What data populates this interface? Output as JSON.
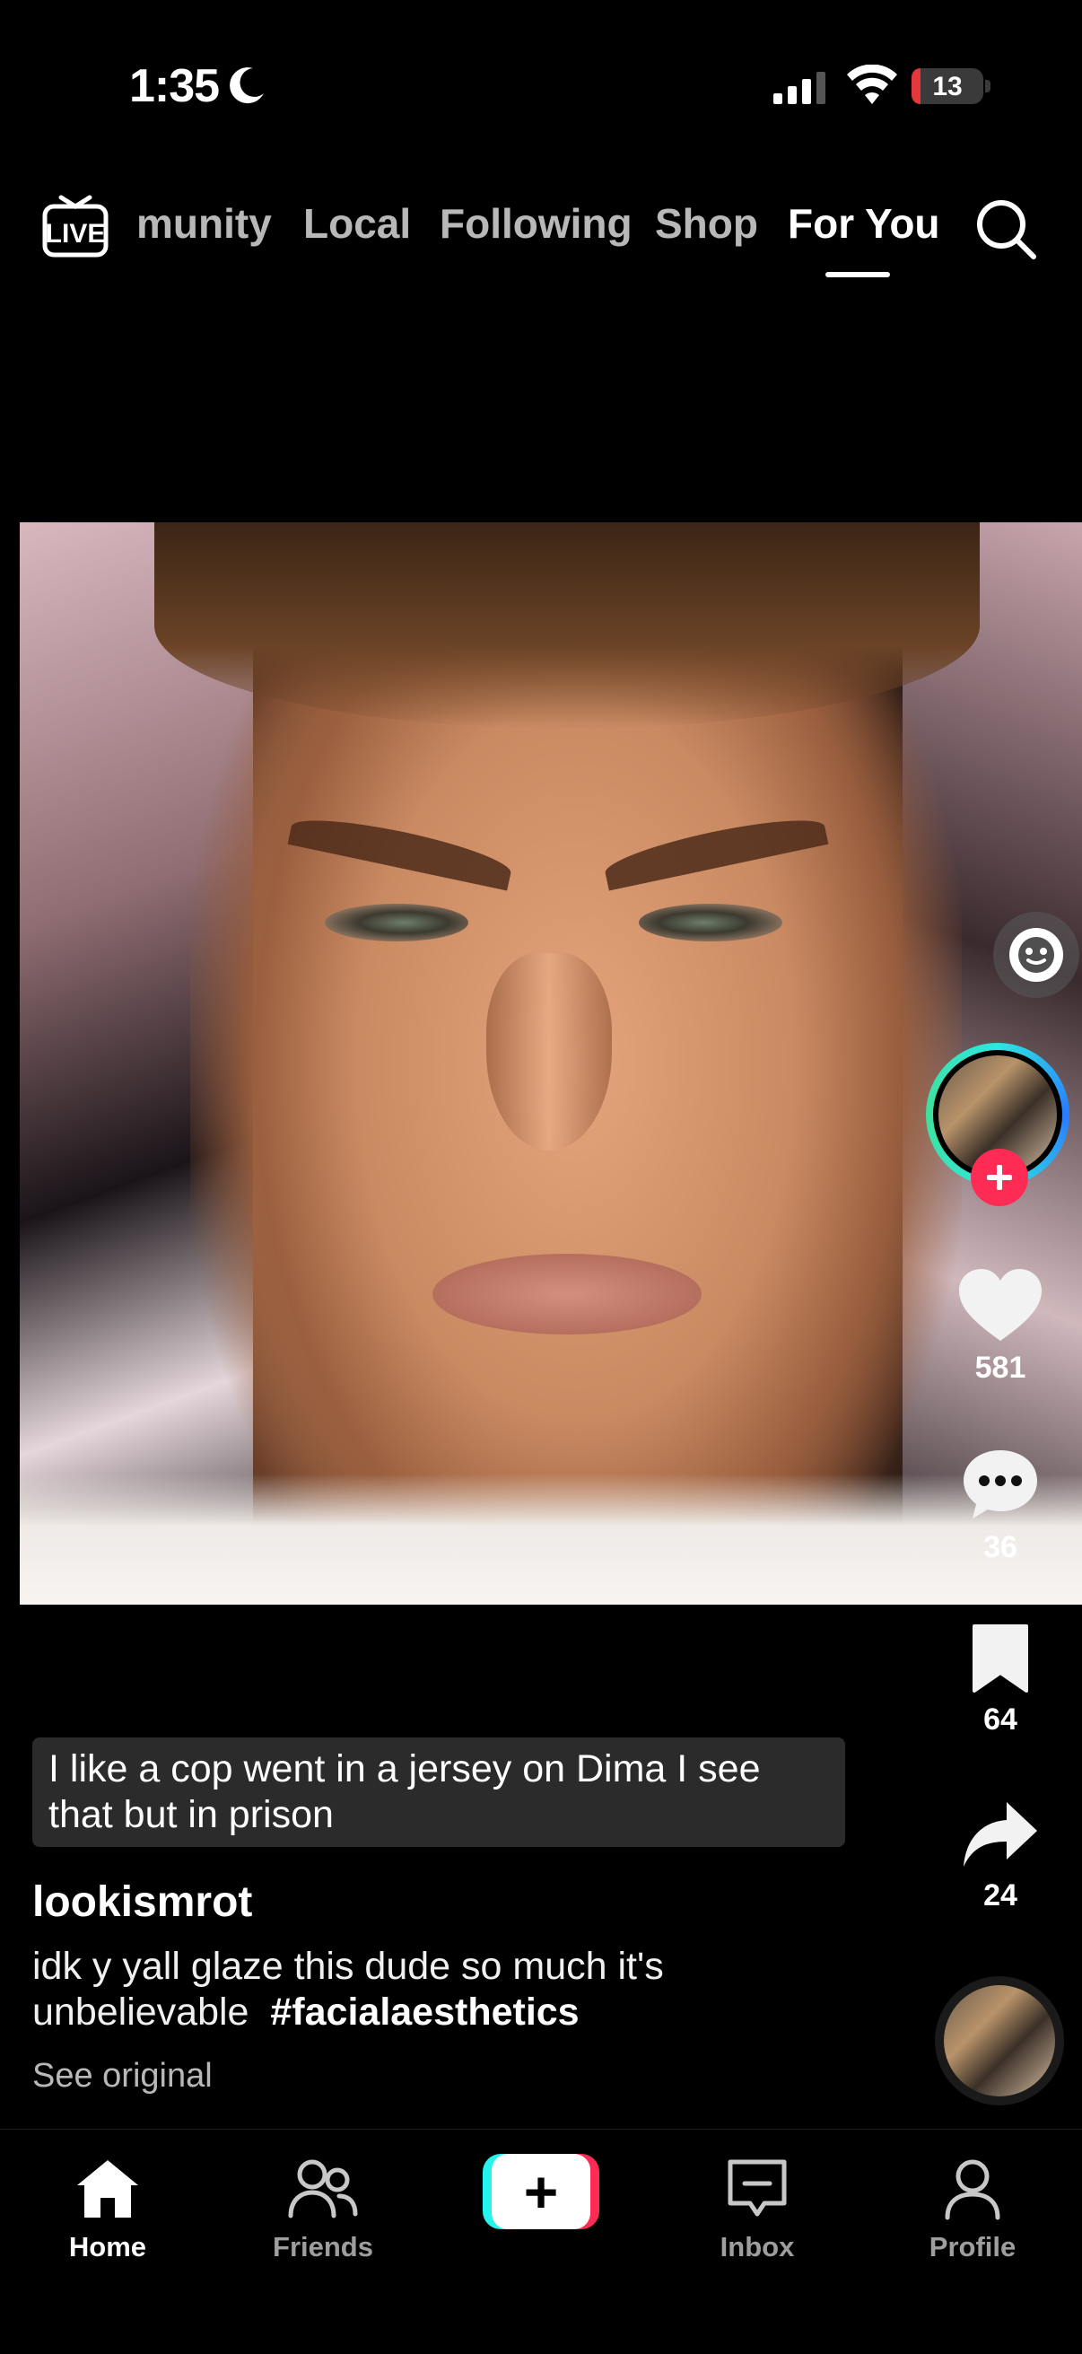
{
  "status_bar": {
    "time": "1:35",
    "battery_level": "13",
    "battery_fraction": 0.13,
    "icons": [
      "moon-icon",
      "signal-icon",
      "wifi-icon",
      "battery-icon"
    ]
  },
  "top_nav": {
    "live_label": "LIVE",
    "tabs": [
      {
        "label": "munity",
        "active": false
      },
      {
        "label": "Local",
        "active": false
      },
      {
        "label": "Following",
        "active": false
      },
      {
        "label": "Shop",
        "active": false
      },
      {
        "label": "For You",
        "active": true
      }
    ],
    "search_icon": "search-icon"
  },
  "actions": {
    "likes": "581",
    "comments": "36",
    "bookmarks": "64",
    "shares": "24"
  },
  "post": {
    "comment_preview": "I like a cop went in a jersey on Dima I see that but in prison",
    "username": "lookismrot",
    "description": "idk y yall glaze this dude so much it's unbelievable",
    "hashtag": "#facialaesthetics",
    "see_original": "See original"
  },
  "bottom_nav": {
    "items": [
      {
        "label": "Home",
        "icon": "home-icon",
        "active": true
      },
      {
        "label": "Friends",
        "icon": "friends-icon",
        "active": false
      },
      {
        "label": "Inbox",
        "icon": "inbox-icon",
        "active": false
      },
      {
        "label": "Profile",
        "icon": "profile-icon",
        "active": false
      }
    ],
    "create_icon": "plus-icon"
  },
  "colors": {
    "accent_red": "#fe2c55",
    "accent_cyan": "#25f4ee",
    "battery_low": "#e5383b",
    "background": "#000000"
  }
}
